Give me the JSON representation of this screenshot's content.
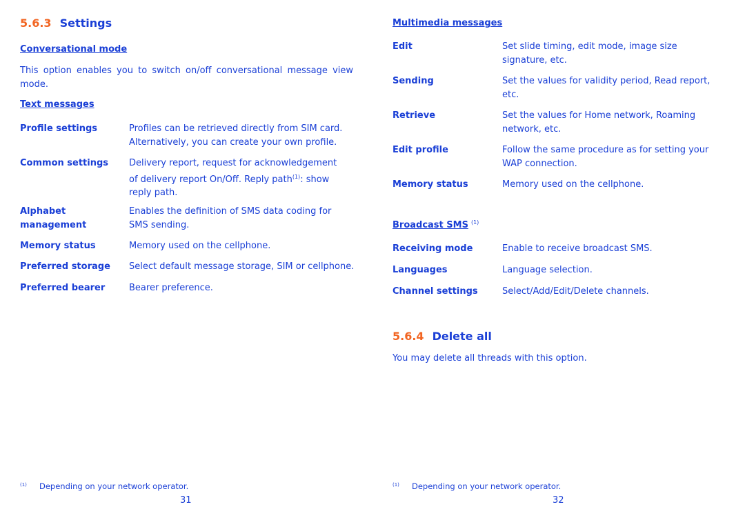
{
  "left_page": {
    "section": {
      "number": "5.6.3",
      "title": "Settings"
    },
    "conversational": {
      "heading": "Conversational mode",
      "text": "This option enables you to switch on/off conversational message view mode."
    },
    "text_messages": {
      "heading": "Text messages",
      "rows": [
        {
          "term": "Profile settings",
          "desc": "Profiles can be retrieved directly from SIM card. Alternatively, you can create your own profile."
        },
        {
          "term": "Common settings",
          "desc_before": "Delivery report, request for acknowledgement of delivery report On/Off. Reply path",
          "sup": "(1)",
          "desc_after": ": show reply path."
        },
        {
          "term": "Alphabet management",
          "desc": "Enables the definition of SMS data coding for SMS sending."
        },
        {
          "term": "Memory status",
          "desc": "Memory used on the cellphone."
        },
        {
          "term": "Preferred storage",
          "desc": "Select default message storage, SIM or cellphone."
        },
        {
          "term": "Preferred bearer",
          "desc": "Bearer preference."
        }
      ]
    },
    "footnote": {
      "mark": "(1)",
      "text": "Depending on your network operator."
    },
    "page_number": "31"
  },
  "right_page": {
    "multimedia": {
      "heading": "Multimedia messages",
      "rows": [
        {
          "term": "Edit",
          "desc": "Set slide timing, edit mode, image size signature, etc."
        },
        {
          "term": "Sending",
          "desc": "Set the values for validity period, Read report, etc."
        },
        {
          "term": "Retrieve",
          "desc": "Set the values for Home network, Roaming network, etc."
        },
        {
          "term": "Edit profile",
          "desc": "Follow the same procedure as for setting your WAP connection."
        },
        {
          "term": "Memory status",
          "desc": "Memory used on the cellphone."
        }
      ]
    },
    "broadcast": {
      "heading": "Broadcast SMS",
      "sup": "(1)",
      "rows": [
        {
          "term": "Receiving mode",
          "desc": "Enable to receive broadcast SMS."
        },
        {
          "term": "Languages",
          "desc": "Language selection."
        },
        {
          "term": "Channel settings",
          "desc": "Select/Add/Edit/Delete channels."
        }
      ]
    },
    "section": {
      "number": "5.6.4",
      "title": "Delete all"
    },
    "delete_text": "You may delete all threads with this option.",
    "footnote": {
      "mark": "(1)",
      "text": "Depending on your network operator."
    },
    "page_number": "32"
  },
  "colors": {
    "text": "#1a3fd6",
    "section_number": "#f26522"
  }
}
